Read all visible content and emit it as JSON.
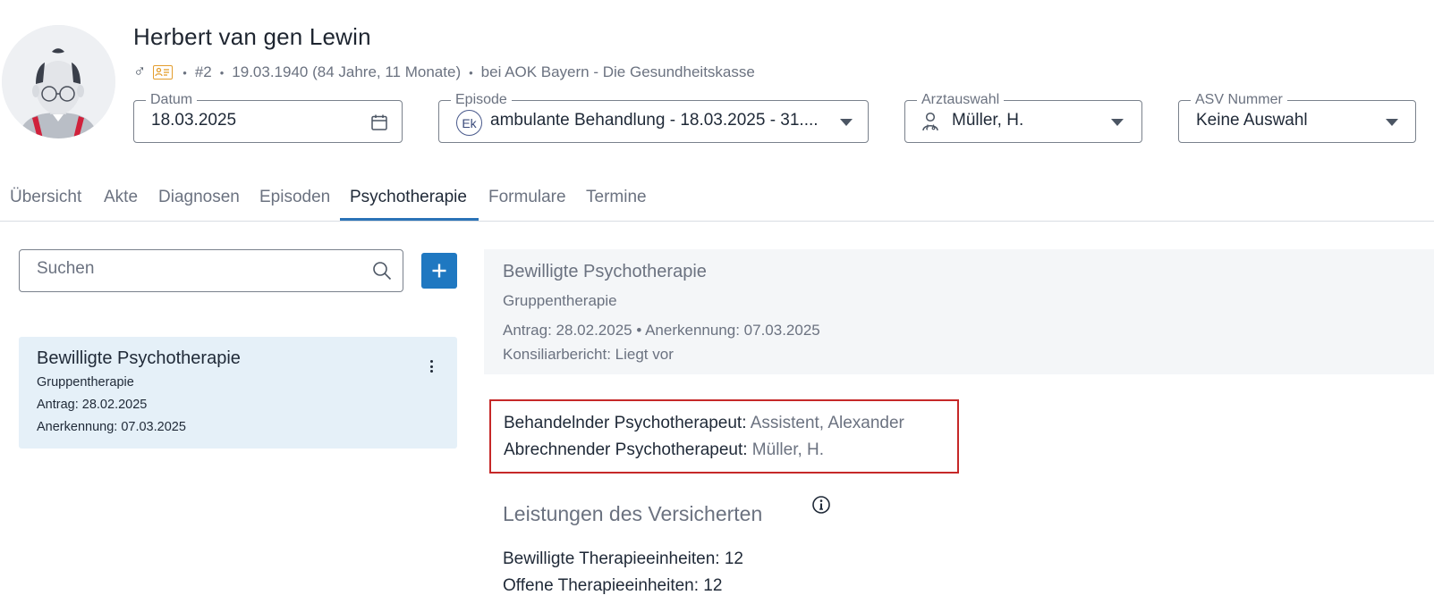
{
  "patient": {
    "name": "Herbert van gen Lewin",
    "gender_symbol": "♂",
    "number": "#2",
    "birth": "19.03.1940 (84 Jahre, 11 Monate)",
    "insurance": "bei AOK Bayern - Die Gesundheitskasse"
  },
  "filters": {
    "date": {
      "label": "Datum",
      "value": "18.03.2025"
    },
    "episode": {
      "label": "Episode",
      "badge": "Ek",
      "value": "ambulante Behandlung - 18.03.2025 - 31...."
    },
    "doctor": {
      "label": "Arztauswahl",
      "value": "Müller, H."
    },
    "asv": {
      "label": "ASV Nummer",
      "value": "Keine Auswahl"
    }
  },
  "tabs": [
    {
      "label": "Übersicht"
    },
    {
      "label": "Akte"
    },
    {
      "label": "Diagnosen"
    },
    {
      "label": "Episoden"
    },
    {
      "label": "Psychotherapie"
    },
    {
      "label": "Formulare"
    },
    {
      "label": "Termine"
    }
  ],
  "active_tab": "Psychotherapie",
  "search": {
    "placeholder": "Suchen"
  },
  "list": [
    {
      "title": "Bewilligte Psychotherapie",
      "subtitle": "Gruppentherapie",
      "antrag": "Antrag: 28.02.2025",
      "anerkennung": "Anerkennung: 07.03.2025"
    }
  ],
  "detail": {
    "title": "Bewilligte Psychotherapie",
    "type": "Gruppentherapie",
    "dates": "Antrag: 28.02.2025 • Anerkennung: 07.03.2025",
    "konsiliar": "Konsiliarbericht: Liegt vor",
    "behandelnder_label": "Behandelnder Psychotherapeut:",
    "behandelnder_value": "Assistent, Alexander",
    "abrechnender_label": "Abrechnender Psychotherapeut:",
    "abrechnender_value": "Müller, H.",
    "section_title": "Leistungen des Versicherten",
    "bewilligte": "Bewilligte Therapieeinheiten: 12",
    "offene": "Offene Therapieeinheiten: 12"
  },
  "colors": {
    "accent": "#1f78c1",
    "highlight_border": "#c62828",
    "selected_card": "#e5f0f8"
  }
}
